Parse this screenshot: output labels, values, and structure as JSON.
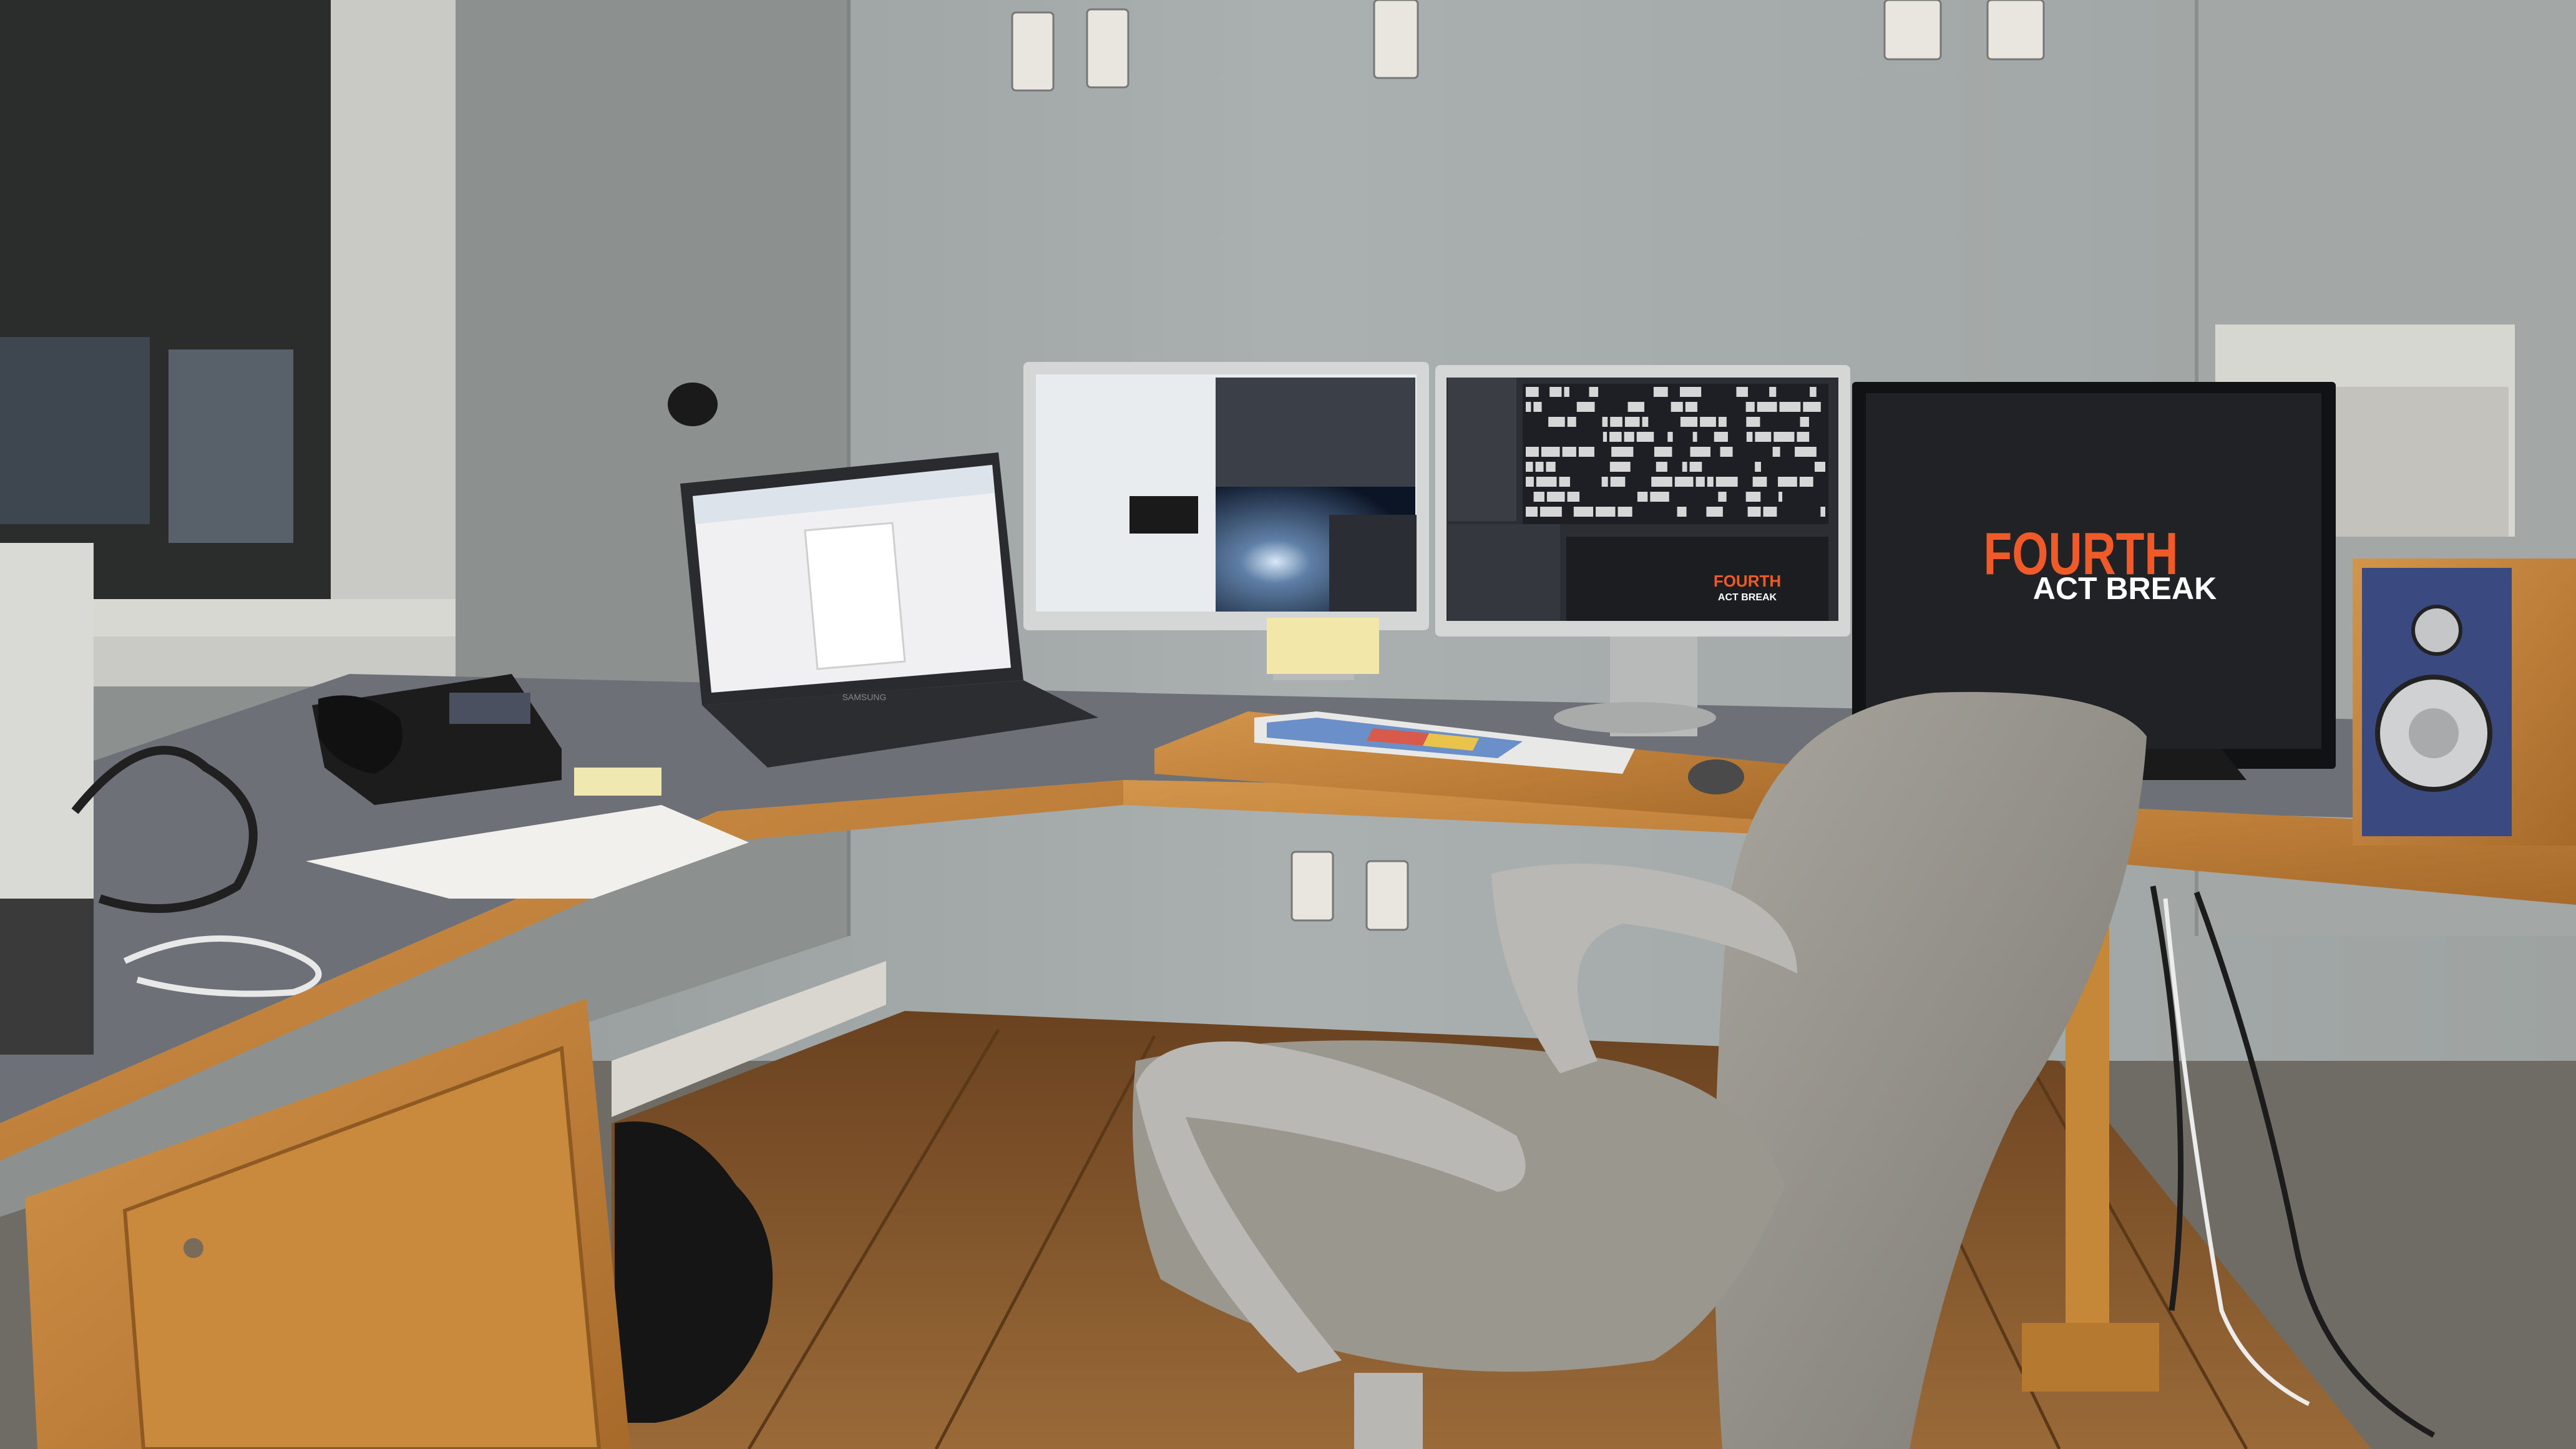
{
  "scene": {
    "right_monitor": {
      "title_line_1": "FOURTH",
      "title_line_2": "ACT BREAK"
    },
    "small_monitor_preview": {
      "title_line_1": "FOURTH",
      "title_line_2": "ACT BREAK"
    },
    "laptop": {
      "brand": "SAMSUNG"
    }
  },
  "colors": {
    "wall": "#a6acac",
    "desk_top": "#6b7075",
    "wood": "#c98a3e",
    "floor": "#8a5a2c",
    "accent_title": "#f05a28",
    "screen_dark": "#202226"
  }
}
